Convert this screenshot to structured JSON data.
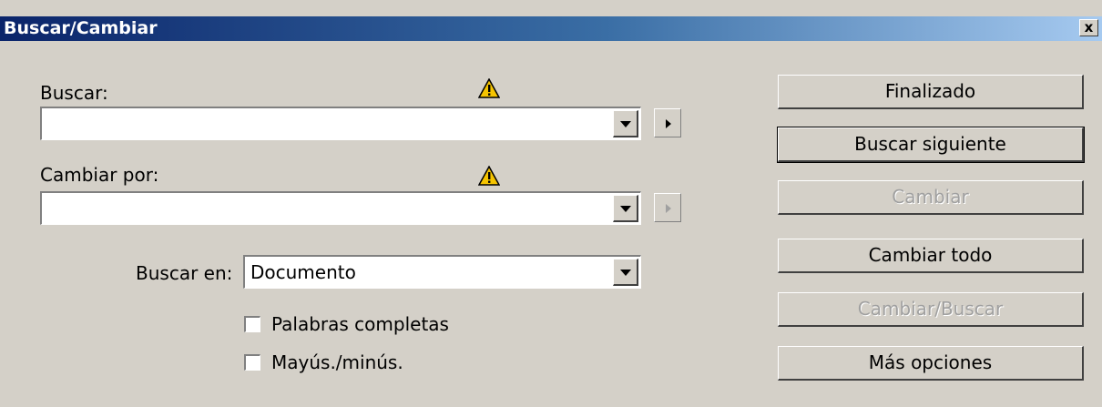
{
  "window": {
    "title": "Buscar/Cambiar",
    "close_label": "x"
  },
  "find": {
    "label": "Buscar:",
    "value": "",
    "warning_icon": "warning-triangle-icon"
  },
  "replace": {
    "label": "Cambiar por:",
    "value": "",
    "warning_icon": "warning-triangle-icon"
  },
  "search_in": {
    "label": "Buscar en:",
    "value": "Documento"
  },
  "options": [
    {
      "label": "Palabras completas",
      "checked": false
    },
    {
      "label": "Mayús./minús.",
      "checked": false
    }
  ],
  "buttons": {
    "done": "Finalizado",
    "find_next": "Buscar siguiente",
    "change": "Cambiar",
    "change_all": "Cambiar todo",
    "change_find": "Cambiar/Buscar",
    "more_options": "Más opciones"
  },
  "colors": {
    "dialog_bg": "#d4d0c8",
    "title_start": "#0a246a",
    "title_end": "#a6caf0",
    "disabled_text": "#a0a0a0"
  }
}
